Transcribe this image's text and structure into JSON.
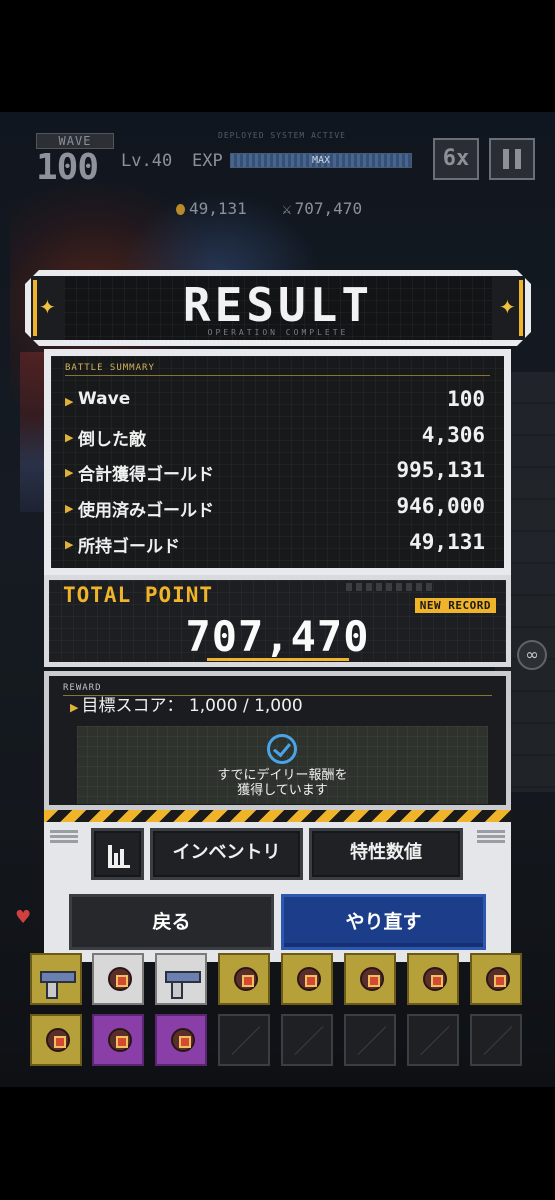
{
  "hud": {
    "wave_label": "WAVE",
    "wave_number": "100",
    "level": "Lv.40",
    "exp_label": "EXP",
    "exp_status": "MAX",
    "exp_progress": 1.0,
    "system_status": "DEPLOYED SYSTEM ACTIVE",
    "speed": "6x",
    "gold": "49,131",
    "kills_score": "707,470"
  },
  "result": {
    "title": "RESULT",
    "subtitle": "OPERATION COMPLETE"
  },
  "summary": {
    "tag": "BATTLE SUMMARY",
    "rows": [
      {
        "label": "Wave",
        "value": "100"
      },
      {
        "label": "倒した敵",
        "value": "4,306"
      },
      {
        "label": "合計獲得ゴールド",
        "value": "995,131"
      },
      {
        "label": "使用済みゴールド",
        "value": "946,000"
      },
      {
        "label": "所持ゴールド",
        "value": "49,131"
      }
    ]
  },
  "total": {
    "label": "TOTAL POINT",
    "badge": "NEW RECORD",
    "value": "707,470"
  },
  "reward": {
    "tag": "REWARD",
    "title": "目標スコア： 1,000 / 1,000",
    "message_line1": "すでにデイリー報酬を",
    "message_line2": "獲得しています",
    "status_icon": "check-circle-icon"
  },
  "actions": {
    "stats_icon": "bar-chart-icon",
    "inventory_label": "インベントリ",
    "traits_label": "特性数値",
    "back_label": "戻る",
    "retry_label": "やり直す"
  },
  "colors": {
    "accent": "#f0b42a",
    "retry": "#1b3d8a",
    "check": "#49a4ea"
  }
}
